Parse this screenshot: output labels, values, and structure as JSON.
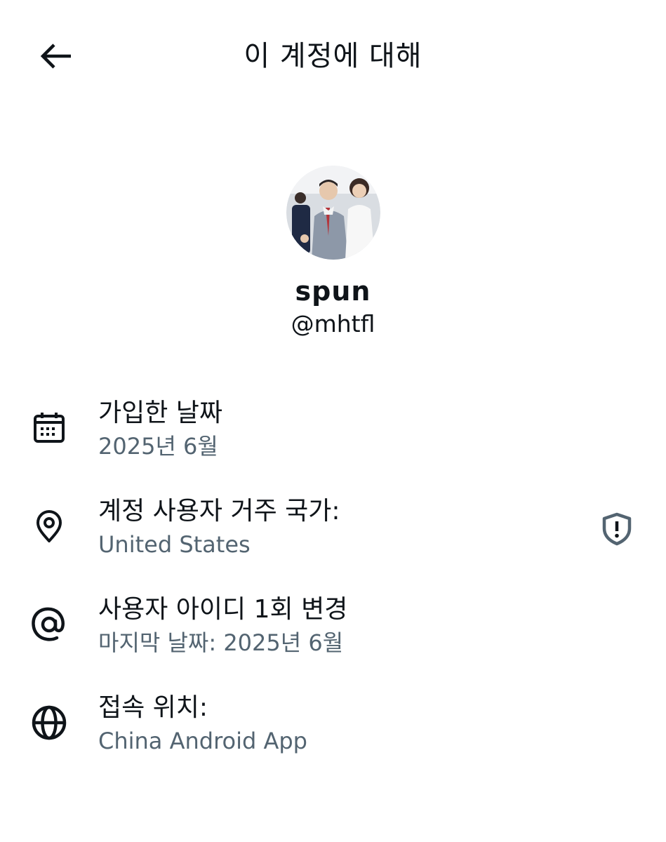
{
  "header": {
    "title": "이 계정에 대해",
    "back_icon": "arrow-left-icon"
  },
  "profile": {
    "avatar_icon": "avatar-photo",
    "display_name": "spun",
    "handle": "@mhtfl"
  },
  "info": {
    "joined": {
      "icon": "calendar-icon",
      "label": "가입한 날짜",
      "value": "2025년 6월"
    },
    "country": {
      "icon": "location-pin-icon",
      "label": "계정 사용자 거주 국가:",
      "value": "United States",
      "action_icon": "shield-alert-icon"
    },
    "username_change": {
      "icon": "at-sign-icon",
      "label": "사용자 아이디 1회 변경",
      "value": "마지막 날짜: 2025년 6월"
    },
    "connected_via": {
      "icon": "globe-icon",
      "label": "접속 위치:",
      "value": "China Android App"
    }
  },
  "colors": {
    "text_primary": "#0f1419",
    "text_secondary": "#536471",
    "background": "#ffffff"
  }
}
